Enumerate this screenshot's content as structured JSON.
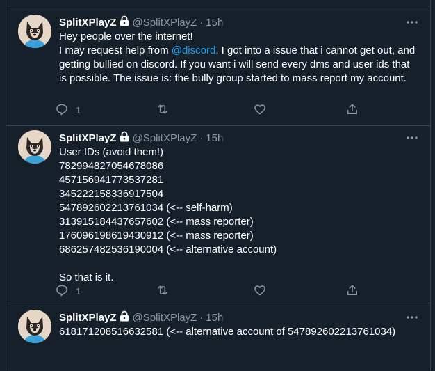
{
  "tweets": [
    {
      "name": "SplitXPlayZ",
      "handle": "@SplitXPlayZ",
      "separator": "·",
      "time": "15h",
      "lines": [
        "Hey people over the internet!",
        {
          "before": "I may request help from ",
          "mention": "@discord",
          "after": ". I got into a issue that i cannot get out, and getting bullied on discord. If you want i will send every dms and user ids that is possible. The issue is: the bully group started to mass report my account."
        }
      ],
      "reply_count": "1"
    },
    {
      "name": "SplitXPlayZ",
      "handle": "@SplitXPlayZ",
      "separator": "·",
      "time": "15h",
      "lines": [
        "User IDs (avoid them!)",
        "782994827054678086",
        "457156941773537281",
        "345222158336917504",
        "547892602213761034 (<-- self-harm)",
        "313915184437657602 (<-- mass reporter)",
        "176096198619430912 (<-- mass reporter)",
        "686257482536190004 (<-- alternative account)",
        "",
        "So that is it."
      ],
      "reply_count": "1"
    },
    {
      "name": "SplitXPlayZ",
      "handle": "@SplitXPlayZ",
      "separator": "·",
      "time": "15h",
      "lines": [
        "618171208516632581 (<-- alternative account of 547892602213761034)"
      ]
    }
  ],
  "icons": {
    "lock": "lock-icon",
    "more": "more-icon",
    "reply": "reply-icon",
    "retweet": "retweet-icon",
    "like": "like-icon",
    "share": "share-icon"
  },
  "colors": {
    "background": "#15202b",
    "text": "#ffffff",
    "muted": "#8899a6",
    "accent": "#1da1f2",
    "border": "#38444d"
  }
}
